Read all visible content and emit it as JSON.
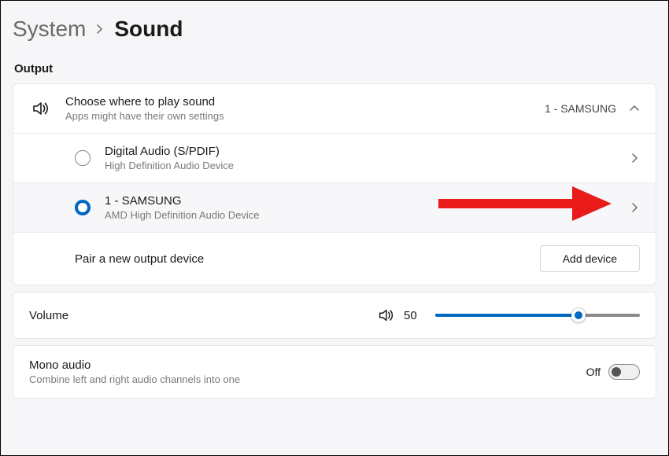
{
  "breadcrumb": {
    "parent": "System",
    "current": "Sound"
  },
  "section": {
    "output_label": "Output"
  },
  "output_header": {
    "title": "Choose where to play sound",
    "subtitle": "Apps might have their own settings",
    "current_device": "1 - SAMSUNG"
  },
  "devices": [
    {
      "name": "Digital Audio (S/PDIF)",
      "sub": "High Definition Audio Device",
      "selected": false
    },
    {
      "name": "1 - SAMSUNG",
      "sub": "AMD High Definition Audio Device",
      "selected": true
    }
  ],
  "pair": {
    "label": "Pair a new output device",
    "button": "Add device"
  },
  "volume": {
    "label": "Volume",
    "value": "50",
    "percent": 70
  },
  "mono": {
    "title": "Mono audio",
    "subtitle": "Combine left and right audio channels into one",
    "state_label": "Off",
    "enabled": false
  },
  "icons": {
    "speaker": "speaker-icon",
    "chevron_up": "chevron-up-icon",
    "chevron_right": "chevron-right-icon"
  },
  "colors": {
    "accent": "#0067c0",
    "annotation": "#e81a1a"
  }
}
